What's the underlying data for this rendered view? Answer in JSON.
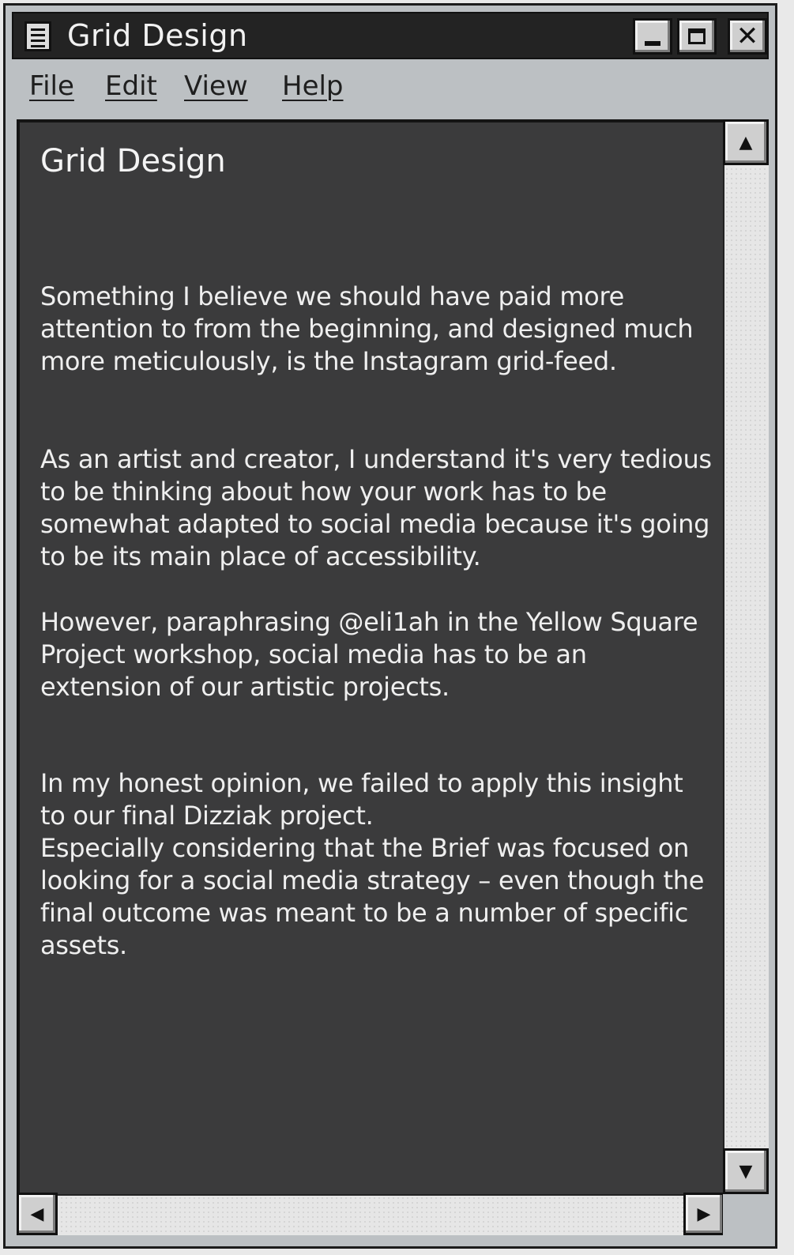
{
  "window": {
    "title": "Grid Design",
    "app_icon": "notepad-icon",
    "controls": {
      "minimize_icon": "minimize-icon",
      "maximize_icon": "maximize-icon",
      "close_icon": "close-icon",
      "close_glyph": "✕"
    }
  },
  "menu": {
    "file": "File",
    "edit": "Edit",
    "view": "View",
    "help": "Help"
  },
  "document": {
    "title": "Grid Design",
    "paragraphs": [
      "Something I believe we should have paid more attention to from the beginning, and designed much more meticulously, is the Instagram grid-feed.",
      "As an artist and creator, I understand it's very tedious to be thinking about how your work has to be somewhat adapted to social media because it's going to be its main place of accessibility.",
      "However, paraphrasing @eli1ah in the Yellow Square Project workshop, social media has to be an extension of our artistic projects.",
      "In my honest opinion, we failed to apply this insight to our final Dizziak project.\nEspecially considering that the Brief was focused on looking for a social media strategy – even though the final outcome was meant to be a number of specific assets."
    ]
  },
  "scrollbars": {
    "up_arrow": "▲",
    "down_arrow": "▼",
    "left_arrow": "◀",
    "right_arrow": "▶"
  },
  "colors": {
    "document_background": "#3b3b3c",
    "document_text": "#efefef",
    "titlebar": "#232323",
    "chrome": "#bcc0c3"
  }
}
